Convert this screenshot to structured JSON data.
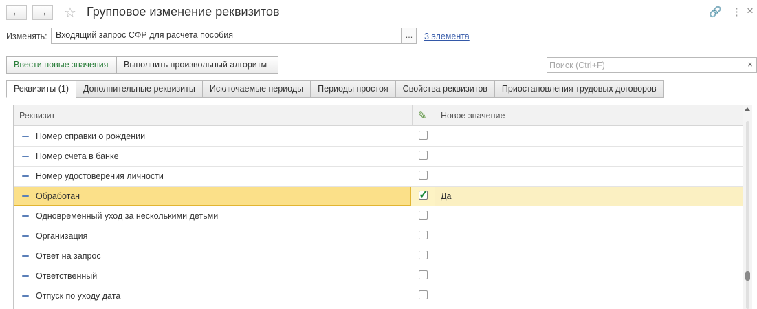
{
  "window": {
    "title": "Групповое изменение реквизитов",
    "back_icon": "←",
    "forward_icon": "→",
    "star_icon": "☆",
    "link_icon": "🔗",
    "more_icon": "⋮",
    "close_icon": "×"
  },
  "change_row": {
    "label": "Изменять:",
    "value": "Входящий запрос СФР для расчета пособия",
    "dots": "...",
    "link": "3 элемента"
  },
  "toolbar": {
    "enter_new_values": "Ввести новые значения",
    "run_algorithm": "Выполнить произвольный алгоритм",
    "search_placeholder": "Поиск (Ctrl+F)",
    "clear": "×"
  },
  "tabs": [
    {
      "label": "Реквизиты (1)",
      "active": true
    },
    {
      "label": "Дополнительные реквизиты",
      "active": false
    },
    {
      "label": "Исключаемые периоды",
      "active": false
    },
    {
      "label": "Периоды простоя",
      "active": false
    },
    {
      "label": "Свойства реквизитов",
      "active": false
    },
    {
      "label": "Приостановления трудовых договоров",
      "active": false
    }
  ],
  "table": {
    "columns": {
      "attribute": "Реквизит",
      "new_value": "Новое значение",
      "edit_icon": "✎"
    },
    "rows": [
      {
        "name": "Номер справки о рождении",
        "checked": false,
        "value": ""
      },
      {
        "name": "Номер счета в банке",
        "checked": false,
        "value": ""
      },
      {
        "name": "Номер удостоверения личности",
        "checked": false,
        "value": ""
      },
      {
        "name": "Обработан",
        "checked": true,
        "value": "Да"
      },
      {
        "name": "Одновременный уход за несколькими детьми",
        "checked": false,
        "value": ""
      },
      {
        "name": "Организация",
        "checked": false,
        "value": ""
      },
      {
        "name": "Ответ на запрос",
        "checked": false,
        "value": ""
      },
      {
        "name": "Ответственный",
        "checked": false,
        "value": ""
      },
      {
        "name": "Отпуск по уходу дата",
        "checked": false,
        "value": ""
      }
    ]
  },
  "colors": {
    "accent_green": "#2a7e3a",
    "selection": "#fbe089",
    "link": "#3358a8"
  }
}
